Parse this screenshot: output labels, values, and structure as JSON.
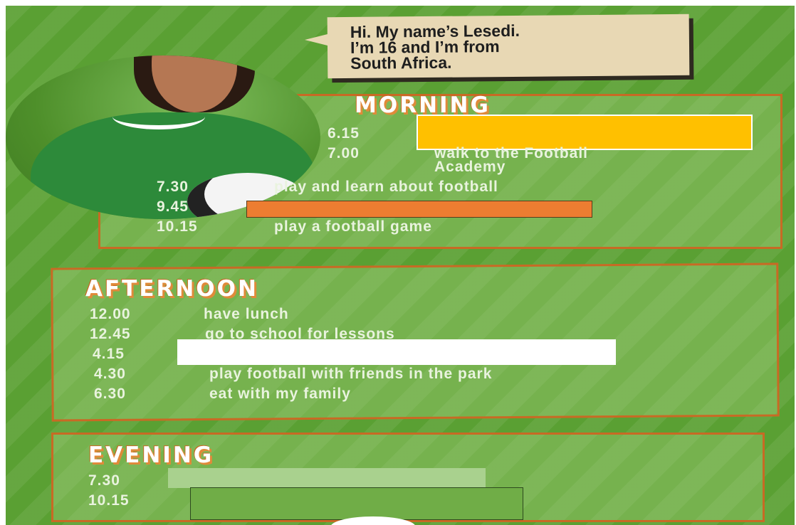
{
  "bubble": {
    "line1": "Hi. My name’s Lesedi.",
    "line2": "I’m 16 and I’m from",
    "line3": "South Africa."
  },
  "morning": {
    "heading": "MORNING",
    "items": [
      {
        "time": "6.15",
        "activity": ""
      },
      {
        "time": "7.00",
        "activity": "walk to the Football",
        "activity2": "Academy"
      },
      {
        "time": "7.30",
        "activity": "play and learn about football"
      },
      {
        "time": "9.45",
        "activity": ""
      },
      {
        "time": "10.15",
        "activity": "play a football game"
      }
    ]
  },
  "afternoon": {
    "heading": "AFTERNOON",
    "items": [
      {
        "time": "12.00",
        "activity": "have lunch"
      },
      {
        "time": "12.45",
        "activity": "go to school for lessons"
      },
      {
        "time": "4.15",
        "activity": ""
      },
      {
        "time": "4.30",
        "activity": "play football with friends in the park"
      },
      {
        "time": "6.30",
        "activity": "eat with my family"
      }
    ]
  },
  "evening": {
    "heading": "EVENING",
    "items": [
      {
        "time": "7.30",
        "activity": ""
      },
      {
        "time": "10.15",
        "activity": ""
      }
    ]
  },
  "colors": {
    "background": "#5aa033",
    "panel_border": "#c86a24",
    "mask_yellow": "#ffc000",
    "mask_orange": "#ed7d31",
    "mask_white": "#ffffff",
    "mask_light_green": "#a9d18e",
    "mask_green": "#70ad47"
  }
}
